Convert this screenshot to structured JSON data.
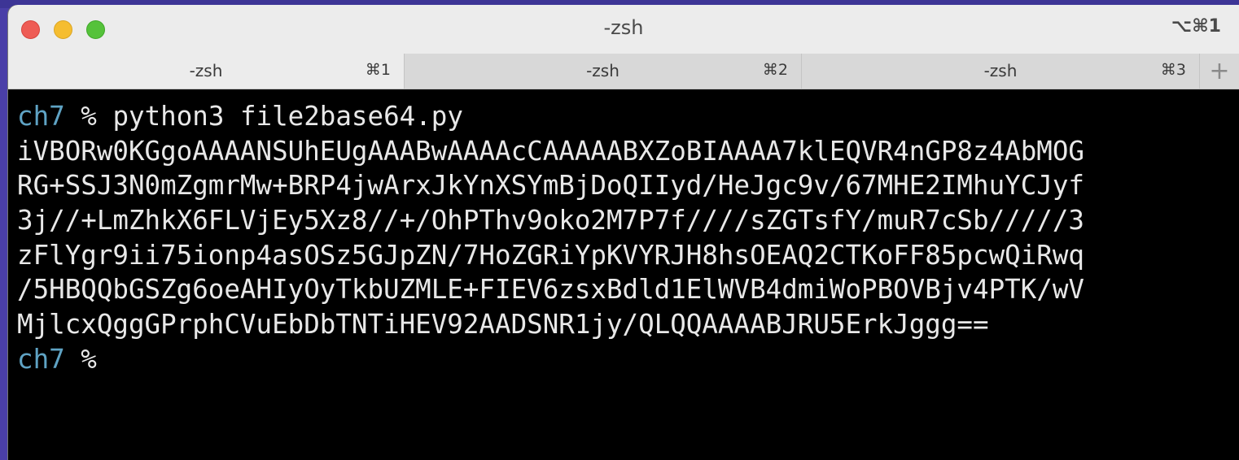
{
  "window": {
    "title": "-zsh",
    "shortcut": "⌥⌘1"
  },
  "tabs": [
    {
      "label": "-zsh",
      "shortcut": "⌘1",
      "active": true
    },
    {
      "label": "-zsh",
      "shortcut": "⌘2",
      "active": false
    },
    {
      "label": "-zsh",
      "shortcut": "⌘3",
      "active": false
    }
  ],
  "new_tab_label": "+",
  "terminal": {
    "prompt_cwd": "ch7",
    "prompt_symbol": "%",
    "command": "python3 file2base64.py",
    "output_lines": [
      "iVBORw0KGgoAAAANSUhEUgAAABwAAAAcCAAAAABXZoBIAAAA7klEQVR4nGP8z4AbMOG",
      "RG+SSJ3N0mZgmrMw+BRP4jwArxJkYnXSYmBjDoQIIyd/HeJgc9v/67MHE2IMhuYCJyf",
      "3j//+LmZhkX6FLVjEy5Xz8//+/OhPThv9oko2M7P7f////sZGTsfY/muR7cSb/////3",
      "zFlYgr9ii75ionp4asOSz5GJpZN/7HoZGRiYpKVYRJH8hsOEAQ2CTKoFF85pcwQiRwq",
      "/5HBQQbGSZg6oeAHIyOyTkbUZMLE+FIEV6zsxBdld1ElWVB4dmiWoPBOVBjv4PTK/wV",
      "MjlcxQggGPrphCVuEbDbTNTiHEV92AADSNR1jy/QLQQAAAABJRU5ErkJggg=="
    ]
  }
}
